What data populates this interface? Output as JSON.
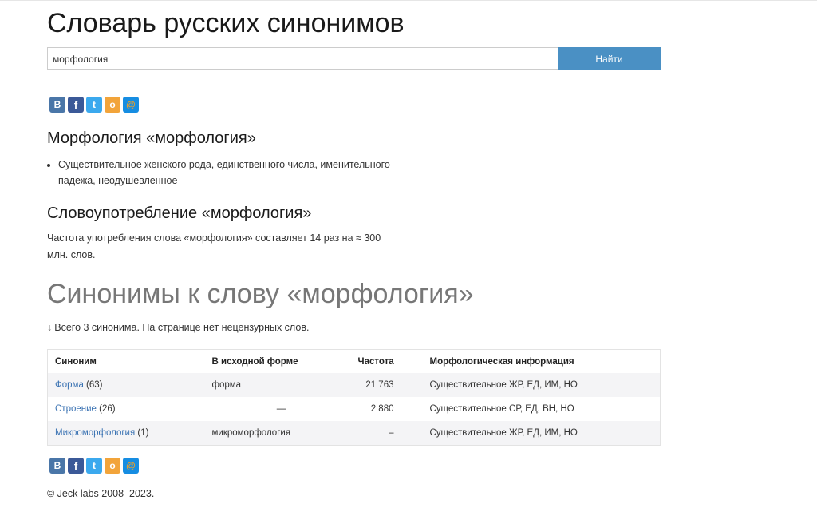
{
  "header": {
    "title": "Словарь русских синонимов"
  },
  "search": {
    "value": "морфология",
    "button_label": "Найти"
  },
  "share": {
    "icons": [
      {
        "name": "vk-icon",
        "glyph": "В",
        "color": "#4a76a8"
      },
      {
        "name": "facebook-icon",
        "glyph": "f",
        "color": "#3b5998"
      },
      {
        "name": "twitter-icon",
        "glyph": "t",
        "color": "#3ba9ee"
      },
      {
        "name": "odnoklassniki-icon",
        "glyph": "о",
        "color": "#f2a43a"
      },
      {
        "name": "mail-icon",
        "glyph": "@",
        "color": "#168de2"
      }
    ]
  },
  "morphology": {
    "heading": "Морфология «морфология»",
    "items": [
      "Существительное женского рода, единственного числа, именительного падежа, неодушевленное"
    ]
  },
  "usage": {
    "heading": "Словоупотребление «морфология»",
    "text": "Частота употребления слова «морфология» составляет 14 раз на ≈ 300 млн. слов."
  },
  "synonyms": {
    "heading": "Синонимы к слову «морфология»",
    "arrow": "↓",
    "summary": "Всего 3 синонима. На странице нет нецензурных слов.",
    "columns": [
      "Синоним",
      "В исходной форме",
      "Частота",
      "Морфологическая информация"
    ],
    "rows": [
      {
        "word": "Форма",
        "count": "(63)",
        "base": "форма",
        "freq": "21 763",
        "info": "Существительное ЖР, ЕД, ИМ, НО"
      },
      {
        "word": "Строение",
        "count": "(26)",
        "base": "—",
        "freq": "2 880",
        "info": "Существительное СР, ЕД, ВН, НО"
      },
      {
        "word": "Микроморфология",
        "count": "(1)",
        "base": "микроморфология",
        "freq": "–",
        "info": "Существительное ЖР, ЕД, ИМ, НО"
      }
    ]
  },
  "footer": {
    "text": "© Jeck labs 2008–2023."
  }
}
